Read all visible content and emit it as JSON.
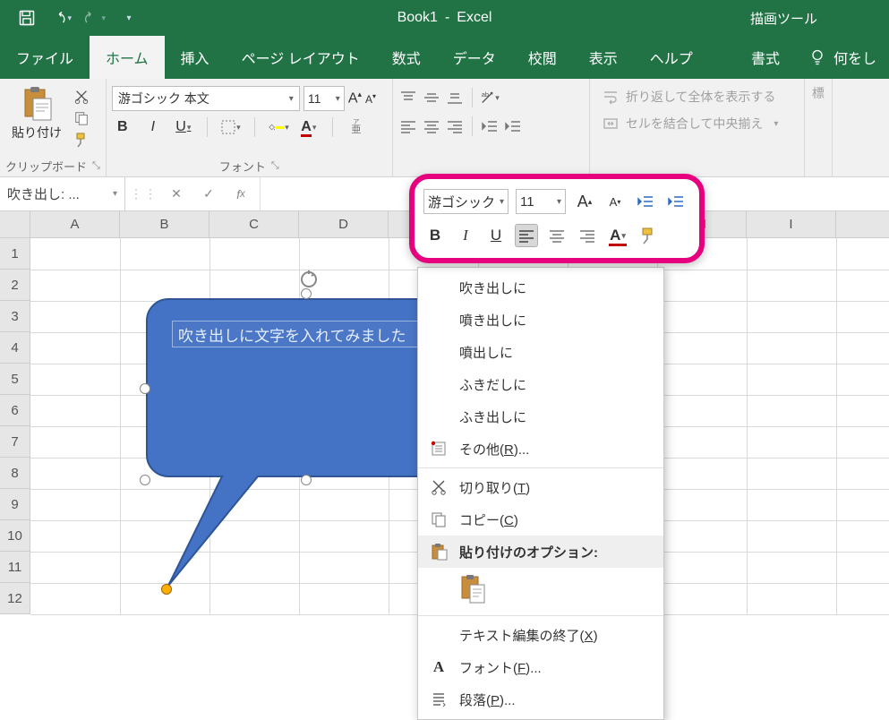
{
  "title": {
    "book": "Book1",
    "app": "Excel"
  },
  "contextual_tab_group": "描画ツール",
  "tabs": {
    "file": "ファイル",
    "home": "ホーム",
    "insert": "挿入",
    "pageLayout": "ページ レイアウト",
    "formulas": "数式",
    "data": "データ",
    "review": "校閲",
    "view": "表示",
    "help": "ヘルプ",
    "format": "書式",
    "tellMe": "何をし"
  },
  "ribbon": {
    "clipboard": {
      "paste": "貼り付け",
      "label": "クリップボード"
    },
    "font": {
      "name": "游ゴシック 本文",
      "size": "11",
      "label": "フォント"
    },
    "alignment": {
      "wrap": "折り返して全体を表示する",
      "merge": "セルを結合して中央揃え"
    },
    "number": {
      "stub": "標"
    }
  },
  "nameBox": "吹き出し: ...",
  "miniToolbar": {
    "font": "游ゴシック",
    "size": "11"
  },
  "shapeText": "吹き出しに文字を入れてみました",
  "columns": [
    "A",
    "B",
    "C",
    "D",
    "",
    "",
    "",
    "H",
    "I"
  ],
  "rows": [
    "1",
    "2",
    "3",
    "4",
    "5",
    "6",
    "7",
    "8",
    "9",
    "10",
    "11",
    "12"
  ],
  "contextMenu": {
    "suggest1": "吹き出しに",
    "suggest2": "噴き出しに",
    "suggest3": "噴出しに",
    "suggest4": "ふきだしに",
    "suggest5": "ふき出しに",
    "more": "その他(",
    "moreMn": "R",
    "moreEnd": ")...",
    "cut": "切り取り(",
    "cutMn": "T",
    "cutEnd": ")",
    "copy": "コピー(",
    "copyMn": "C",
    "copyEnd": ")",
    "pasteOptions": "貼り付けのオプション:",
    "exitEdit": "テキスト編集の終了(",
    "exitMn": "X",
    "exitEnd": ")",
    "font": "フォント(",
    "fontMn": "F",
    "fontEnd": ")...",
    "para": "段落(",
    "paraMn": "P",
    "paraEnd": ")..."
  }
}
